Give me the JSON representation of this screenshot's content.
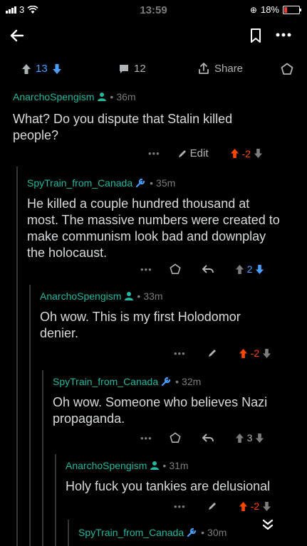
{
  "status": {
    "carrier": "3",
    "time": "13:59",
    "battery": "18%"
  },
  "post_actions": {
    "upvotes": "13",
    "comments": "12",
    "share_label": "Share"
  },
  "comments": [
    {
      "author": "AnarchoSpengism",
      "time": "36m",
      "body_lines": [
        "What? Do you dispute that Stalin killed",
        "people?"
      ],
      "edit_label": "Edit",
      "score": "-2"
    },
    {
      "author": "SpyTrain_from_Canada",
      "time": "35m",
      "body_lines": [
        "He killed a couple hundred thousand at",
        "most. The massive numbers were created to",
        "make communism look bad and downplay",
        "the holocaust."
      ],
      "score": "2"
    },
    {
      "author": "AnarchoSpengism",
      "time": "33m",
      "body_lines": [
        "Oh wow. This is my first Holodomor",
        "denier."
      ],
      "score": "-2"
    },
    {
      "author": "SpyTrain_from_Canada",
      "time": "32m",
      "body_lines": [
        "Oh wow. Someone who believes Nazi",
        "propaganda."
      ],
      "score": "3"
    },
    {
      "author": "AnarchoSpengism",
      "time": "31m",
      "body_lines": [
        "Holy fuck you tankies are delusional"
      ],
      "score": "-2"
    },
    {
      "author": "SpyTrain_from_Canada",
      "time": "30m",
      "body_lines": []
    }
  ],
  "colors": {
    "author": "#25b79f",
    "downvoted_score": "#ff4500",
    "upvoted_arrow": "#4a9eff"
  }
}
